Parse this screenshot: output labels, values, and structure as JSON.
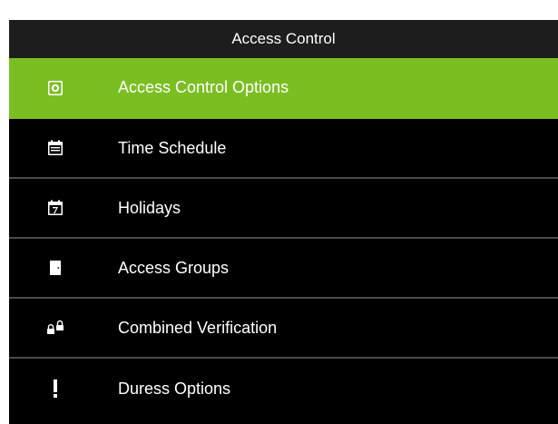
{
  "header": {
    "title": "Access Control"
  },
  "menu": {
    "items": [
      {
        "label": "Access Control Options",
        "icon": "settings-square-icon",
        "selected": true
      },
      {
        "label": "Time Schedule",
        "icon": "calendar-icon",
        "selected": false
      },
      {
        "label": "Holidays",
        "icon": "calendar-7-icon",
        "selected": false
      },
      {
        "label": "Access Groups",
        "icon": "door-icon",
        "selected": false
      },
      {
        "label": "Combined Verification",
        "icon": "locks-icon",
        "selected": false
      },
      {
        "label": "Duress Options",
        "icon": "exclamation-icon",
        "selected": false
      }
    ]
  },
  "colors": {
    "selected_bg": "#7bbe22",
    "menu_bg": "#000000",
    "title_bg": "#1d1d1d",
    "divider": "#4a4a4a"
  }
}
